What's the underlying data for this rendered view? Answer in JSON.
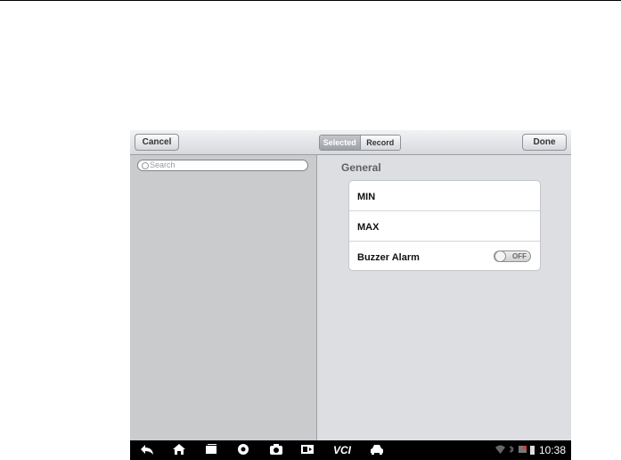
{
  "toolbar": {
    "cancel_label": "Cancel",
    "done_label": "Done",
    "segments": {
      "selected_label": "Selected",
      "record_label": "Record"
    }
  },
  "search": {
    "placeholder": "Search"
  },
  "settings": {
    "section_title": "General",
    "rows": [
      {
        "label": "MIN"
      },
      {
        "label": "MAX"
      },
      {
        "label": "Buzzer Alarm",
        "toggle_state": "OFF"
      }
    ]
  },
  "navbar": {
    "icons": [
      "back-icon",
      "home-icon",
      "recent-apps-icon",
      "browser-icon",
      "camera-icon",
      "screen-record-icon",
      "vci-icon",
      "car-icon"
    ],
    "vci_label": "VCI",
    "status_icons": [
      "wifi-icon",
      "bluetooth-icon",
      "notification-icon",
      "battery-icon"
    ],
    "time": "10:38"
  },
  "colors": {
    "toolbar_top": "#f1f2f4",
    "pane_left": "#c9cbcd",
    "pane_right": "#dcdee2",
    "navbar": "#000000"
  }
}
